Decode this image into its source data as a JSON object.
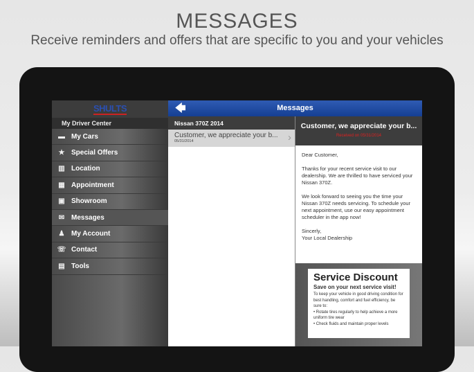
{
  "header": {
    "title": "MESSAGES",
    "subtitle": "Receive reminders and offers that are specific to you and your vehicles"
  },
  "sidebar": {
    "logo": "SHULTS",
    "section": "My Driver Center",
    "items": [
      {
        "label": "My Cars",
        "icon": "garage-icon",
        "glyph": "▬"
      },
      {
        "label": "Special Offers",
        "icon": "star-icon",
        "glyph": "★"
      },
      {
        "label": "Location",
        "icon": "map-icon",
        "glyph": "▥"
      },
      {
        "label": "Appointment",
        "icon": "calendar-icon",
        "glyph": "▦"
      },
      {
        "label": "Showroom",
        "icon": "car-icon",
        "glyph": "▣"
      },
      {
        "label": "Messages",
        "icon": "envelope-icon",
        "glyph": "✉"
      },
      {
        "label": "My Account",
        "icon": "person-icon",
        "glyph": "♟"
      },
      {
        "label": "Contact",
        "icon": "contact-icon",
        "glyph": "☏"
      },
      {
        "label": "Tools",
        "icon": "toolbox-icon",
        "glyph": "▤"
      }
    ]
  },
  "topbar": {
    "title": "Messages",
    "back": "🡄"
  },
  "list": {
    "section": "Nissan 370Z 2014",
    "items": [
      {
        "title": "Customer, we appreciate your b...",
        "date": "05/31/2014"
      }
    ]
  },
  "detail": {
    "title": "Customer, we appreciate your b...",
    "received": "Received on 05/31/2014",
    "paragraphs": [
      "Dear Customer,",
      "Thanks for your recent service visit to our dealership. We are thrilled to have serviced your Nissan 370Z.",
      "We look forward to seeing you the time your Nissan 370Z needs servicing. To schedule your next appointment, use our easy appointment scheduler in the app now!",
      "Sincerly,\nYour Local Dealership"
    ],
    "promo": {
      "title": "Service Discount",
      "subtitle": "Save on your next service visit!",
      "text": "To keep your vehicle in good driving condition for best handling, comfort and fuel efficiency, be sure to:",
      "bullets": [
        "• Rotate tires regularly to help achieve a more uniform tire wear",
        "• Check fluids and maintain proper levels"
      ]
    }
  }
}
